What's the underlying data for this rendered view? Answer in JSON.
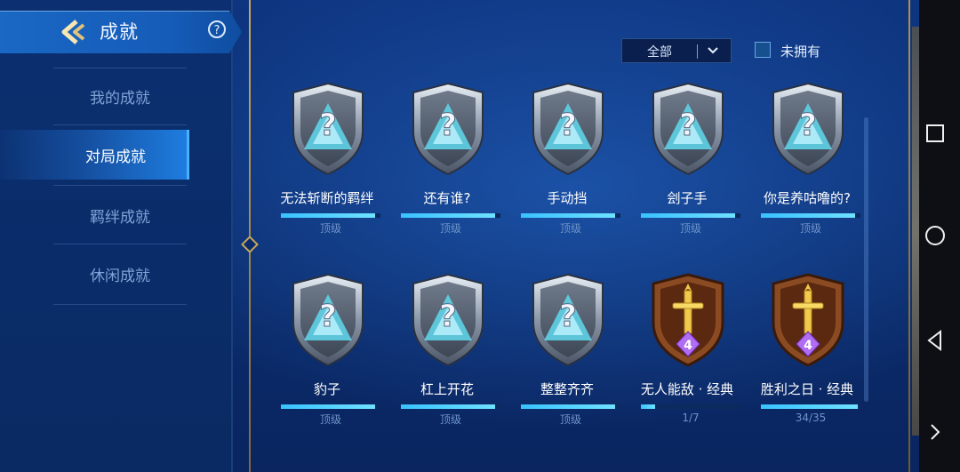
{
  "header": {
    "title": "成就",
    "help_symbol": "?"
  },
  "sidebar": {
    "items": [
      {
        "label": "我的成就",
        "active": false
      },
      {
        "label": "对局成就",
        "active": true
      },
      {
        "label": "羁绊成就",
        "active": false
      },
      {
        "label": "休闲成就",
        "active": false
      }
    ]
  },
  "filter": {
    "selected": "全部",
    "checkbox_label": "未拥有",
    "checked": false
  },
  "achievements": [
    {
      "name": "无法斩断的羁绊",
      "status": "顶级",
      "progress": 0.95,
      "badge": "locked"
    },
    {
      "name": "还有谁?",
      "status": "顶级",
      "progress": 0.95,
      "badge": "locked"
    },
    {
      "name": "手动挡",
      "status": "顶级",
      "progress": 0.95,
      "badge": "locked"
    },
    {
      "name": "刽子手",
      "status": "顶级",
      "progress": 0.95,
      "badge": "locked"
    },
    {
      "name": "你是养咕噜的?",
      "status": "顶级",
      "progress": 0.95,
      "badge": "locked"
    },
    {
      "name": "豹子",
      "status": "顶级",
      "progress": 0.95,
      "badge": "locked"
    },
    {
      "name": "杠上开花",
      "status": "顶级",
      "progress": 0.95,
      "badge": "locked"
    },
    {
      "name": "整整齐齐",
      "status": "顶级",
      "progress": 0.95,
      "badge": "locked"
    },
    {
      "name": "无人能敌 · 经典",
      "status": "1/7",
      "progress": 0.14,
      "badge": "bronze",
      "level": "4"
    },
    {
      "name": "胜利之日 · 经典",
      "status": "34/35",
      "progress": 0.97,
      "badge": "bronze",
      "level": "4"
    }
  ],
  "colors": {
    "accent": "#39c2ff",
    "panel": "#0b2c6c",
    "gold": "#c9a85a"
  }
}
